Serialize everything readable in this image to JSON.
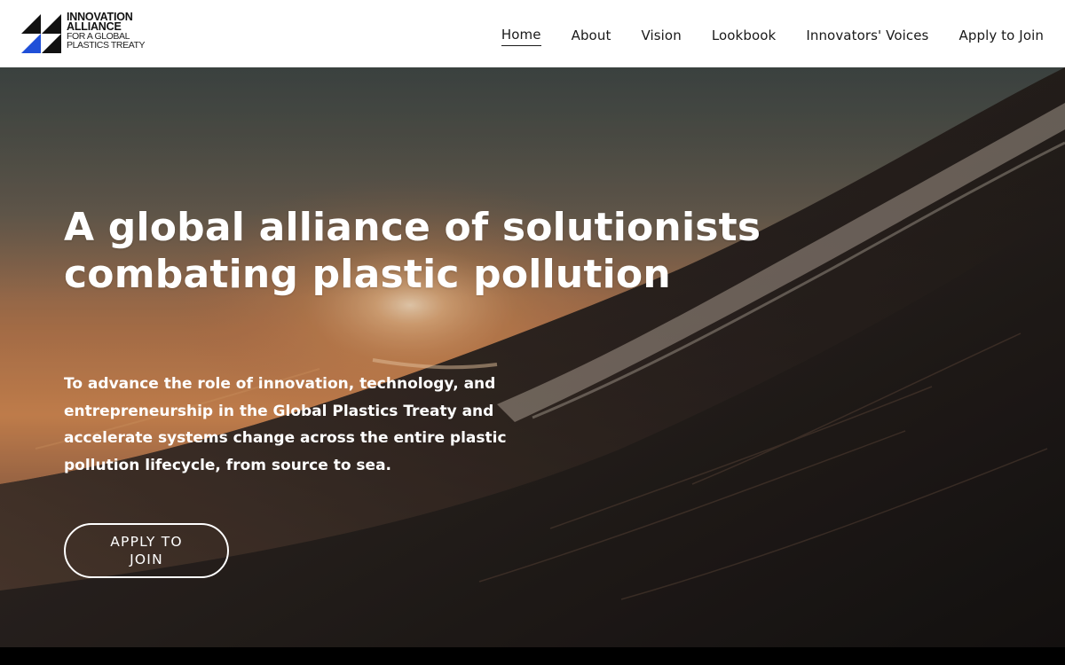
{
  "brand": {
    "name_line1": "INNOVATION",
    "name_line2": "ALLIANCE",
    "name_line3": "FOR A GLOBAL",
    "name_line4": "PLASTICS TREATY"
  },
  "nav": {
    "items": [
      {
        "label": "Home",
        "active": true
      },
      {
        "label": "About"
      },
      {
        "label": "Vision"
      },
      {
        "label": "Lookbook"
      },
      {
        "label": "Innovators' Voices"
      },
      {
        "label": "Apply to Join"
      }
    ]
  },
  "hero": {
    "title": "A global alliance of solutionists combating plastic pollution",
    "subtitle": "To advance the role of innovation, technology, and entrepreneurship in the Global Plastics Treaty and accelerate systems change across the entire plastic pollution lifecycle, from source to sea.",
    "cta_label": "APPLY TO JOIN"
  },
  "colors": {
    "header_bg": "#ffffff",
    "logo_blue": "#1f4fd8",
    "logo_dark": "#111111",
    "text_light": "#ffffff",
    "sunset_orange": "#d9874a"
  },
  "icons": {
    "logo_mark": "triangles-logo-icon"
  }
}
